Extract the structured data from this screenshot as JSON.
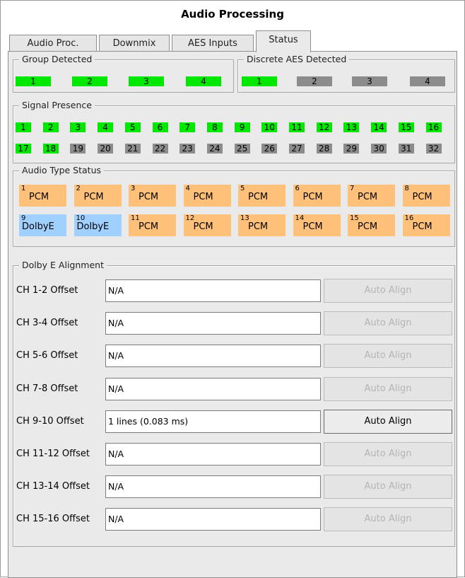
{
  "title": "Audio Processing",
  "tabs": [
    {
      "label": "Audio Proc."
    },
    {
      "label": "Downmix"
    },
    {
      "label": "AES Inputs"
    },
    {
      "label": "Status",
      "active": true
    }
  ],
  "group_detected": {
    "label": "Group Detected",
    "items": [
      {
        "label": "1",
        "on": true
      },
      {
        "label": "2",
        "on": true
      },
      {
        "label": "3",
        "on": true
      },
      {
        "label": "4",
        "on": true
      }
    ]
  },
  "discrete_aes": {
    "label": "Discrete AES Detected",
    "items": [
      {
        "label": "1",
        "on": true
      },
      {
        "label": "2",
        "on": false
      },
      {
        "label": "3",
        "on": false
      },
      {
        "label": "4",
        "on": false
      }
    ]
  },
  "signal_presence": {
    "label": "Signal Presence",
    "items": [
      {
        "label": "1",
        "on": true
      },
      {
        "label": "2",
        "on": true
      },
      {
        "label": "3",
        "on": true
      },
      {
        "label": "4",
        "on": true
      },
      {
        "label": "5",
        "on": true
      },
      {
        "label": "6",
        "on": true
      },
      {
        "label": "7",
        "on": true
      },
      {
        "label": "8",
        "on": true
      },
      {
        "label": "9",
        "on": true
      },
      {
        "label": "10",
        "on": true
      },
      {
        "label": "11",
        "on": true
      },
      {
        "label": "12",
        "on": true
      },
      {
        "label": "13",
        "on": true
      },
      {
        "label": "14",
        "on": true
      },
      {
        "label": "15",
        "on": true
      },
      {
        "label": "16",
        "on": true
      },
      {
        "label": "17",
        "on": true
      },
      {
        "label": "18",
        "on": true
      },
      {
        "label": "19",
        "on": false
      },
      {
        "label": "20",
        "on": false
      },
      {
        "label": "21",
        "on": false
      },
      {
        "label": "22",
        "on": false
      },
      {
        "label": "23",
        "on": false
      },
      {
        "label": "24",
        "on": false
      },
      {
        "label": "25",
        "on": false
      },
      {
        "label": "26",
        "on": false
      },
      {
        "label": "27",
        "on": false
      },
      {
        "label": "28",
        "on": false
      },
      {
        "label": "29",
        "on": false
      },
      {
        "label": "30",
        "on": false
      },
      {
        "label": "31",
        "on": false
      },
      {
        "label": "32",
        "on": false
      }
    ]
  },
  "audio_type_status": {
    "label": "Audio Type Status",
    "items": [
      {
        "num": "1",
        "type": "PCM"
      },
      {
        "num": "2",
        "type": "PCM"
      },
      {
        "num": "3",
        "type": "PCM"
      },
      {
        "num": "4",
        "type": "PCM"
      },
      {
        "num": "5",
        "type": "PCM"
      },
      {
        "num": "6",
        "type": "PCM"
      },
      {
        "num": "7",
        "type": "PCM"
      },
      {
        "num": "8",
        "type": "PCM"
      },
      {
        "num": "9",
        "type": "DolbyE"
      },
      {
        "num": "10",
        "type": "DolbyE"
      },
      {
        "num": "11",
        "type": "PCM"
      },
      {
        "num": "12",
        "type": "PCM"
      },
      {
        "num": "13",
        "type": "PCM"
      },
      {
        "num": "14",
        "type": "PCM"
      },
      {
        "num": "15",
        "type": "PCM"
      },
      {
        "num": "16",
        "type": "PCM"
      }
    ]
  },
  "dolby_alignment": {
    "label": "Dolby E Alignment",
    "button_label": "Auto Align",
    "rows": [
      {
        "label": "CH 1-2 Offset",
        "value": "N/A",
        "enabled": false
      },
      {
        "label": "CH 3-4 Offset",
        "value": "N/A",
        "enabled": false
      },
      {
        "label": "CH 5-6 Offset",
        "value": "N/A",
        "enabled": false
      },
      {
        "label": "CH 7-8 Offset",
        "value": "N/A",
        "enabled": false
      },
      {
        "label": "CH 9-10 Offset",
        "value": "1 lines (0.083 ms)",
        "enabled": true
      },
      {
        "label": "CH 11-12 Offset",
        "value": "N/A",
        "enabled": false
      },
      {
        "label": "CH 13-14 Offset",
        "value": "N/A",
        "enabled": false
      },
      {
        "label": "CH 15-16 Offset",
        "value": "N/A",
        "enabled": false
      }
    ]
  },
  "colors": {
    "detected_on": "#00e800",
    "detected_off": "#8c8c8c",
    "pcm": "#ffc07a",
    "dolby_e": "#9fd0ff",
    "panel_bg": "#eaeaea"
  }
}
